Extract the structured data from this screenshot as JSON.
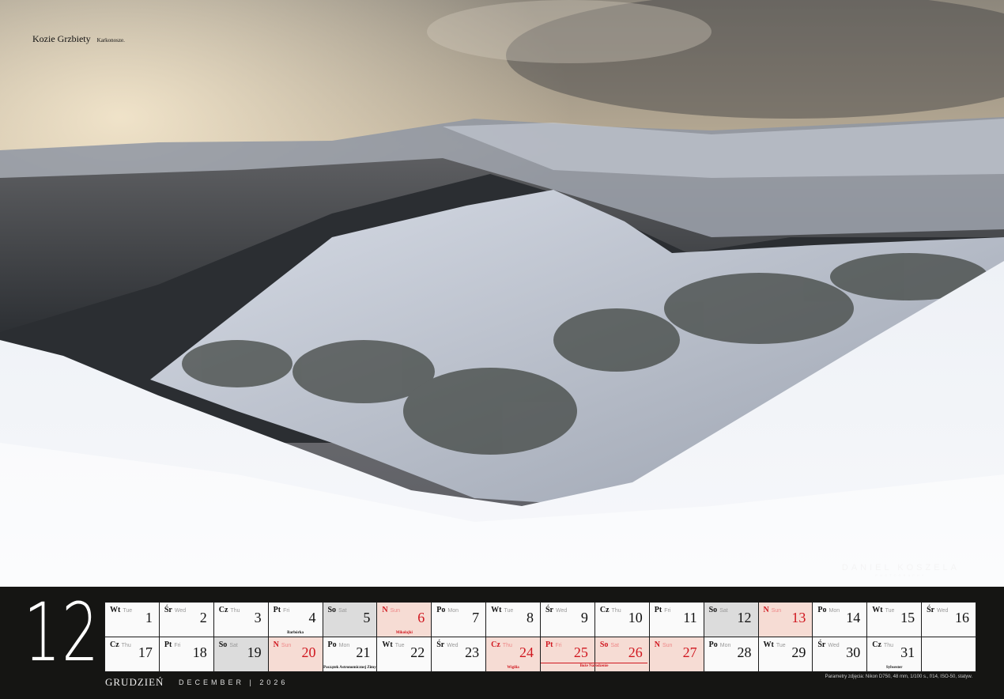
{
  "photo": {
    "title": "Kozie Grzbiety",
    "location": "Karkonosze.",
    "watermark": "DANIEL KOSZELA",
    "watermark_sub": "PHOTOGRAPHY"
  },
  "calendar": {
    "month_number": "12",
    "month_pl": "GRUDZIEŃ",
    "month_en": "DECEMBER | 2026",
    "params": "Parametry zdjęcia: Nikon D750, 48 mm, 1/100 s., f/14, ISO-50, statyw.",
    "holiday_span_note": "Boże Narodzenie",
    "days": [
      {
        "pl": "Wt",
        "en": "Tue",
        "n": "1",
        "type": ""
      },
      {
        "pl": "Śr",
        "en": "Wed",
        "n": "2",
        "type": ""
      },
      {
        "pl": "Cz",
        "en": "Thu",
        "n": "3",
        "type": ""
      },
      {
        "pl": "Pt",
        "en": "Fri",
        "n": "4",
        "type": "",
        "note": "Barbórka"
      },
      {
        "pl": "So",
        "en": "Sat",
        "n": "5",
        "type": "sat"
      },
      {
        "pl": "N",
        "en": "Sun",
        "n": "6",
        "type": "sun",
        "note": "Mikołajki"
      },
      {
        "pl": "Po",
        "en": "Mon",
        "n": "7",
        "type": ""
      },
      {
        "pl": "Wt",
        "en": "Tue",
        "n": "8",
        "type": ""
      },
      {
        "pl": "Śr",
        "en": "Wed",
        "n": "9",
        "type": ""
      },
      {
        "pl": "Cz",
        "en": "Thu",
        "n": "10",
        "type": ""
      },
      {
        "pl": "Pt",
        "en": "Fri",
        "n": "11",
        "type": ""
      },
      {
        "pl": "So",
        "en": "Sat",
        "n": "12",
        "type": "sat"
      },
      {
        "pl": "N",
        "en": "Sun",
        "n": "13",
        "type": "sun"
      },
      {
        "pl": "Po",
        "en": "Mon",
        "n": "14",
        "type": ""
      },
      {
        "pl": "Wt",
        "en": "Tue",
        "n": "15",
        "type": ""
      },
      {
        "pl": "Śr",
        "en": "Wed",
        "n": "16",
        "type": ""
      },
      {
        "pl": "Cz",
        "en": "Thu",
        "n": "17",
        "type": ""
      },
      {
        "pl": "Pt",
        "en": "Fri",
        "n": "18",
        "type": ""
      },
      {
        "pl": "So",
        "en": "Sat",
        "n": "19",
        "type": "sat"
      },
      {
        "pl": "N",
        "en": "Sun",
        "n": "20",
        "type": "sun"
      },
      {
        "pl": "Po",
        "en": "Mon",
        "n": "21",
        "type": "",
        "note": "Początek Astronomicznej Zimy"
      },
      {
        "pl": "Wt",
        "en": "Tue",
        "n": "22",
        "type": ""
      },
      {
        "pl": "Śr",
        "en": "Wed",
        "n": "23",
        "type": ""
      },
      {
        "pl": "Cz",
        "en": "Thu",
        "n": "24",
        "type": "hol",
        "note": "Wigilia"
      },
      {
        "pl": "Pt",
        "en": "Fri",
        "n": "25",
        "type": "hol"
      },
      {
        "pl": "So",
        "en": "Sat",
        "n": "26",
        "type": "hol"
      },
      {
        "pl": "N",
        "en": "Sun",
        "n": "27",
        "type": "sun"
      },
      {
        "pl": "Po",
        "en": "Mon",
        "n": "28",
        "type": ""
      },
      {
        "pl": "Wt",
        "en": "Tue",
        "n": "29",
        "type": ""
      },
      {
        "pl": "Śr",
        "en": "Wed",
        "n": "30",
        "type": ""
      },
      {
        "pl": "Cz",
        "en": "Thu",
        "n": "31",
        "type": "",
        "note": "Sylwester"
      },
      {
        "pl": "",
        "en": "",
        "n": "",
        "type": "empty"
      }
    ]
  }
}
